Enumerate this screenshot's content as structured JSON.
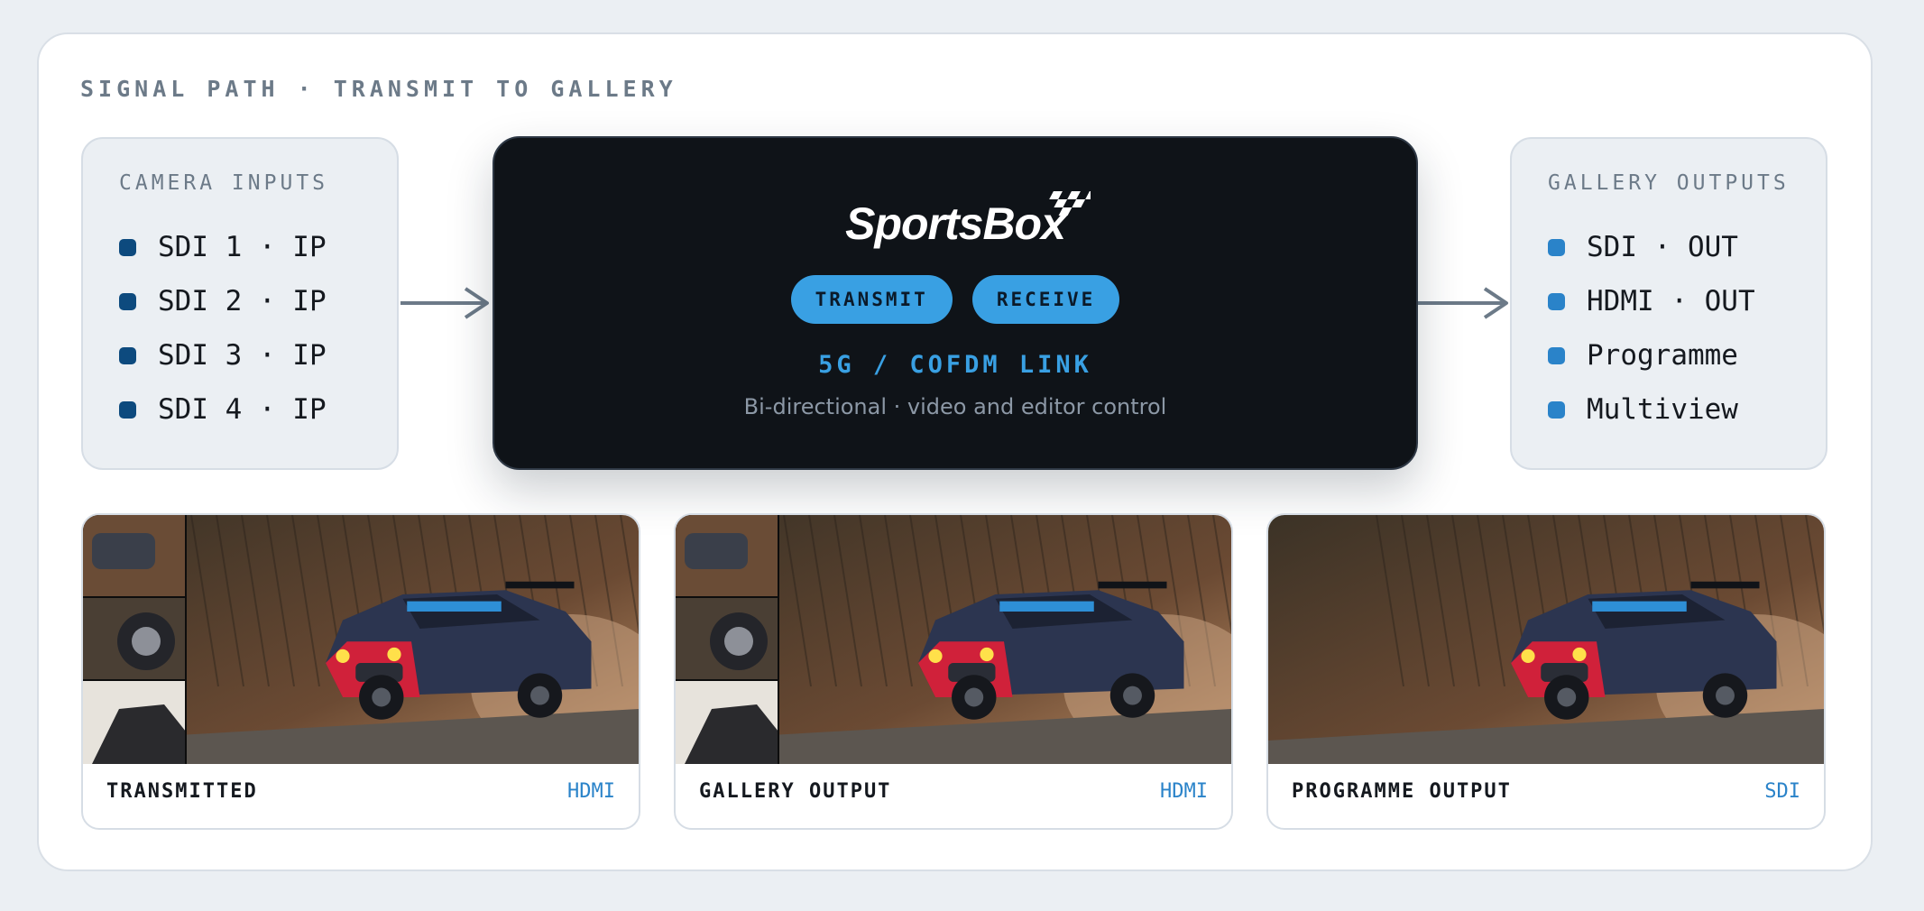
{
  "title": "SIGNAL PATH · TRANSMIT TO GALLERY",
  "camera_inputs": {
    "title": "CAMERA INPUTS",
    "items": [
      "SDI 1 · IP",
      "SDI 2 · IP",
      "SDI 3 · IP",
      "SDI 4 · IP"
    ]
  },
  "gallery_outputs": {
    "title": "GALLERY OUTPUTS",
    "items": [
      "SDI · OUT",
      "HDMI · OUT",
      "Programme",
      "Multiview"
    ]
  },
  "hub": {
    "logo_text": "SportsBox",
    "buttons": {
      "transmit": "TRANSMIT",
      "receive": "RECEIVE"
    },
    "link_title": "5G / COFDM LINK",
    "link_subtitle": "Bi-directional · video and editor control"
  },
  "tiles": [
    {
      "caption": "TRANSMITTED",
      "tag": "HDMI",
      "multiview": true
    },
    {
      "caption": "GALLERY OUTPUT",
      "tag": "HDMI",
      "multiview": true
    },
    {
      "caption": "PROGRAMME OUTPUT",
      "tag": "SDI",
      "multiview": false
    }
  ],
  "colors": {
    "accent": "#39a0e3",
    "input_dot": "#0d4a7e",
    "output_dot": "#2a83c9",
    "hub_bg": "#0f1318"
  },
  "icons": {
    "arrow": "arrow-right-icon",
    "flag": "checkered-flag-icon"
  }
}
